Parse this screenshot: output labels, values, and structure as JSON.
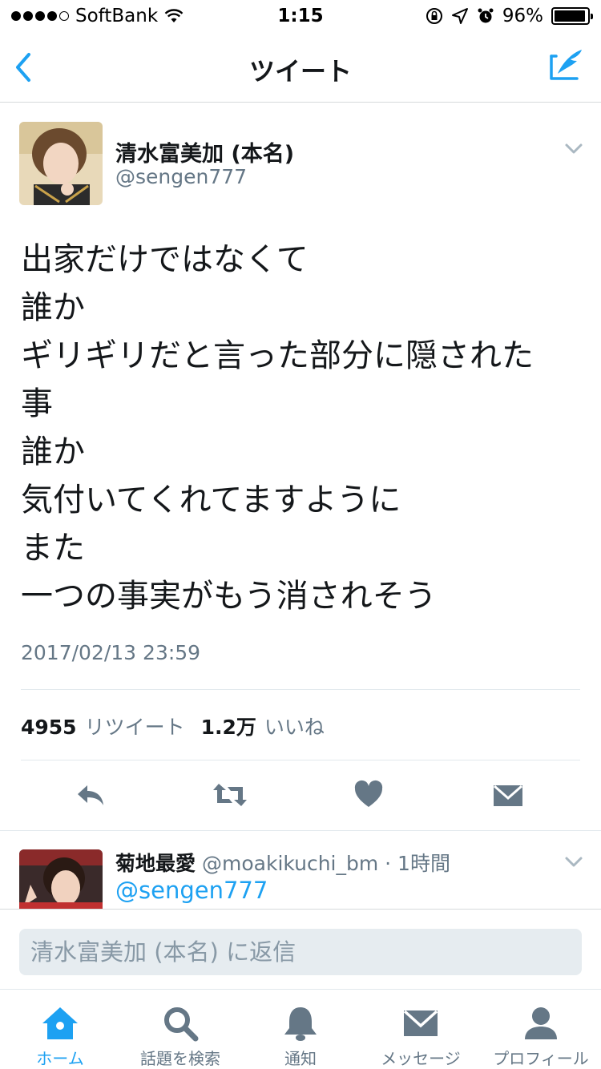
{
  "status_bar": {
    "carrier": "SoftBank",
    "time": "1:15",
    "battery": "96%",
    "battery_level": 0.96
  },
  "nav": {
    "title": "ツイート",
    "accent": "#1da1f2"
  },
  "tweet": {
    "user_name": "清水富美加 (本名)",
    "user_handle": "@sengen777",
    "lines": [
      "出家だけではなくて",
      "誰か",
      "ギリギリだと言った部分に隠された",
      "事",
      "誰か",
      "気付いてくれてますように",
      "また",
      "一つの事実がもう消されそう"
    ],
    "timestamp": "2017/02/13 23:59",
    "retweet_count": "4955",
    "retweet_label": "リツイート",
    "like_count": "1.2万",
    "like_label": "いいね"
  },
  "reply_preview": {
    "user_name": "菊地最愛",
    "meta": "@moakikuchi_bm · 1時間",
    "mention": "@sengen777"
  },
  "reply_bar": {
    "placeholder": "清水富美加 (本名) に返信"
  },
  "tab_bar": {
    "tabs": [
      {
        "label": "ホーム",
        "icon": "home-icon"
      },
      {
        "label": "話題を検索",
        "icon": "search-icon"
      },
      {
        "label": "通知",
        "icon": "bell-icon"
      },
      {
        "label": "メッセージ",
        "icon": "envelope-icon"
      },
      {
        "label": "プロフィール",
        "icon": "person-icon"
      }
    ]
  }
}
